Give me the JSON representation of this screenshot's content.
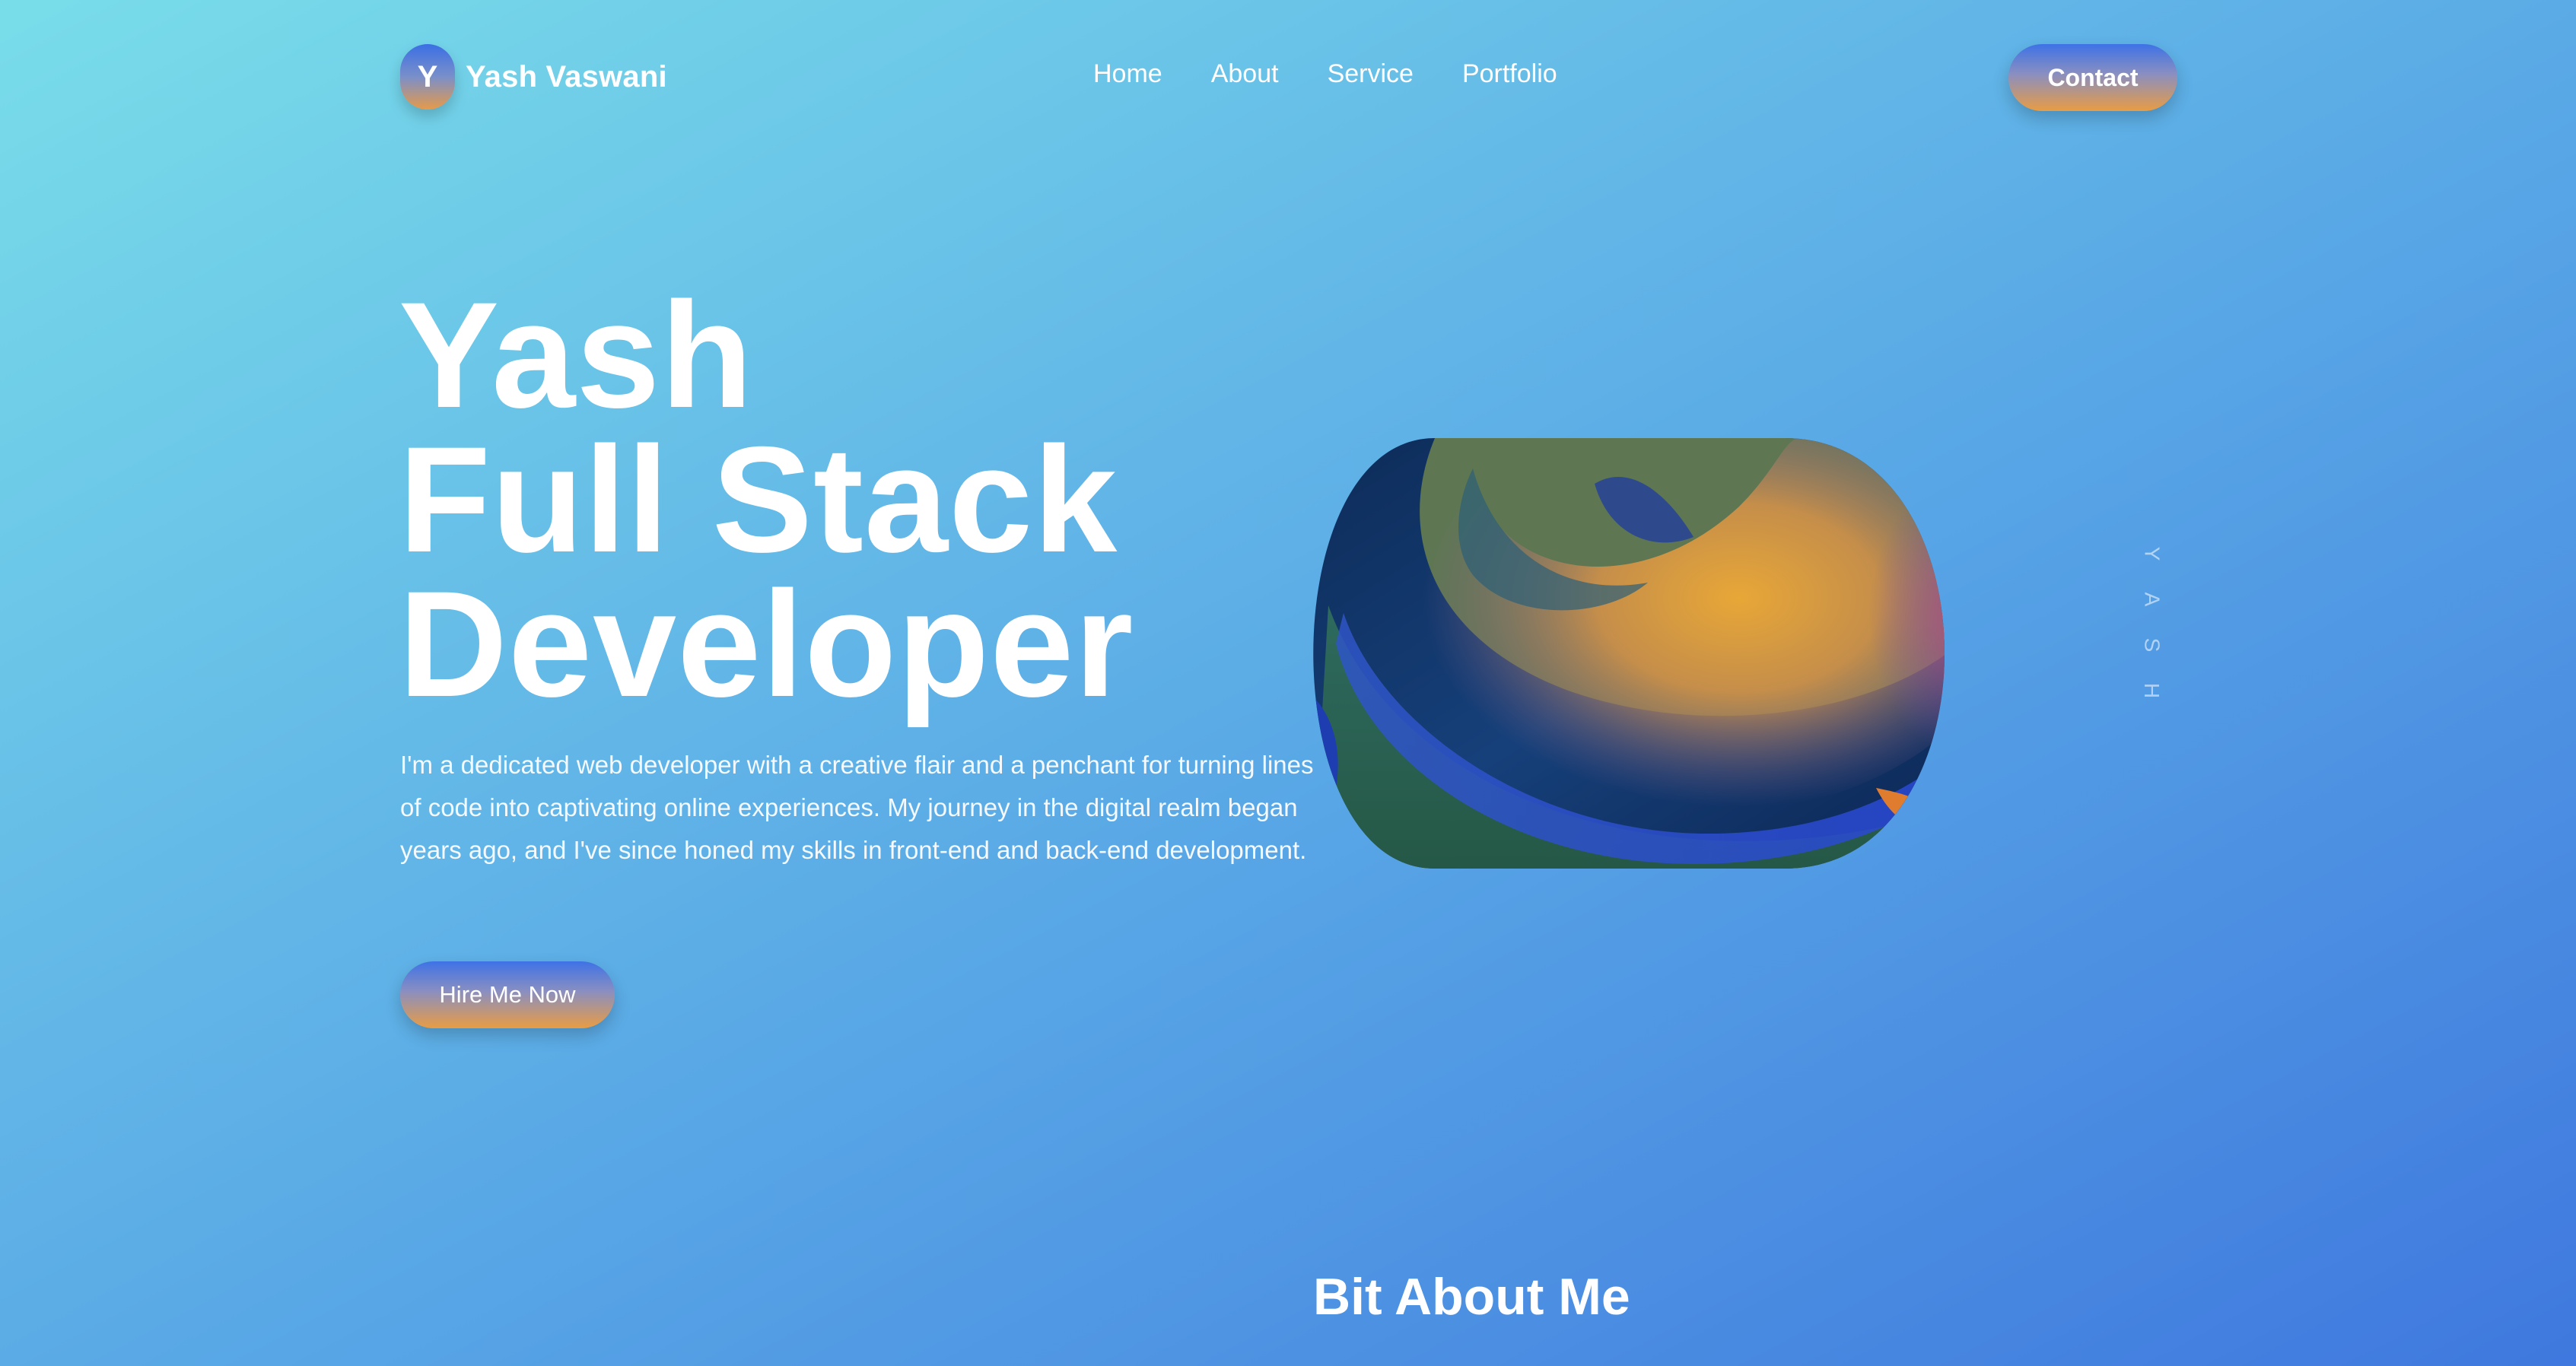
{
  "colors": {
    "bg_start": "#79DDE9",
    "bg_end": "#3F78DE",
    "button_top": "#3E72E6",
    "button_bottom": "#E89C44",
    "text": "#FFFFFF"
  },
  "logo": {
    "badge_letter": "Y",
    "name": "Yash Vaswani"
  },
  "nav": {
    "items": [
      "Home",
      "About",
      "Service",
      "Portfolio"
    ]
  },
  "header": {
    "contact_label": "Contact"
  },
  "hero": {
    "title_lines": [
      "Yash",
      "Full Stack",
      "Developer"
    ],
    "description": "I'm a dedicated web developer with a creative flair and a penchant for turning lines of code into captivating online experiences. My journey in the digital realm began years ago, and I've since honed my skills in front-end and back-end development.",
    "cta_label": "Hire Me Now",
    "art_icon": "abstract-3d-shape-image"
  },
  "side_text": {
    "letters": [
      "Y",
      "A",
      "S",
      "H"
    ]
  },
  "about": {
    "heading": "Bit About Me"
  }
}
